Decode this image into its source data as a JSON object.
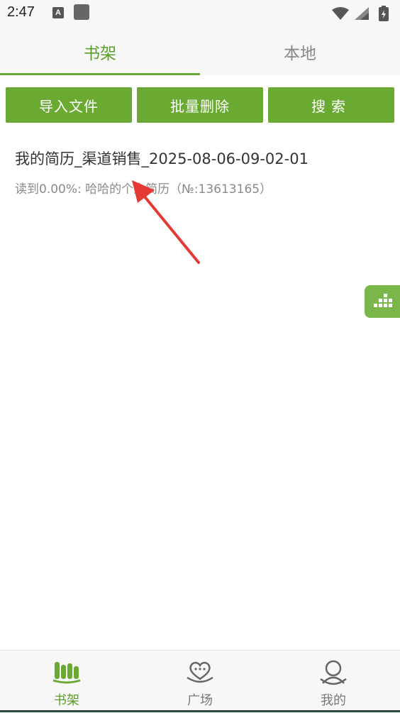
{
  "status_bar": {
    "time": "2:47",
    "notification_icon_letter": "A"
  },
  "top_tabs": {
    "shelf": "书架",
    "local": "本地"
  },
  "actions": {
    "import": "导入文件",
    "batch_delete": "批量删除",
    "search": "搜索"
  },
  "books": [
    {
      "title": "我的简历_渠道销售_2025-08-06-09-02-01",
      "subtitle": "读到0.00%: 哈哈的个人简历（№:13613165）"
    }
  ],
  "bottom_nav": {
    "shelf": "书架",
    "plaza": "广场",
    "mine": "我的"
  },
  "colors": {
    "accent": "#6aaa33",
    "accent_text": "#5a9e2b",
    "annotation_arrow": "#e53935"
  },
  "icons": [
    "wifi-icon",
    "signal-icon",
    "battery-icon",
    "bookshelf-icon",
    "heart-chat-icon",
    "user-icon",
    "stats-icon"
  ]
}
